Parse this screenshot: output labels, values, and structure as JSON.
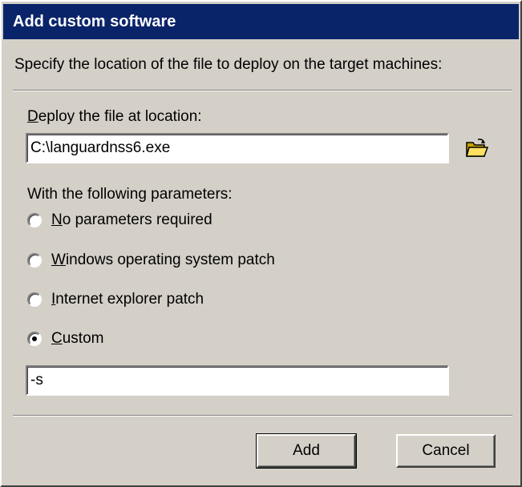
{
  "dialog": {
    "title": "Add custom software",
    "instruction": "Specify the location of the file to deploy on the target machines:",
    "location_label_mnemonic": "D",
    "location_label_rest": "eploy the file at location:",
    "location_value": "C:\\languardnss6.exe",
    "browse_icon": "open-folder-icon",
    "parameters_label": "With the following parameters:",
    "options": [
      {
        "mnemonic": "N",
        "rest": "o parameters required",
        "checked": false
      },
      {
        "mnemonic": "W",
        "rest": "indows operating system patch",
        "checked": false
      },
      {
        "mnemonic": "I",
        "rest": "nternet explorer patch",
        "checked": false
      },
      {
        "mnemonic": "C",
        "rest": "ustom",
        "checked": true
      }
    ],
    "custom_value": "-s",
    "add_label": "Add",
    "cancel_label": "Cancel"
  },
  "colors": {
    "title_bar": "#0a246a",
    "dialog_face": "#d4d0c8"
  }
}
